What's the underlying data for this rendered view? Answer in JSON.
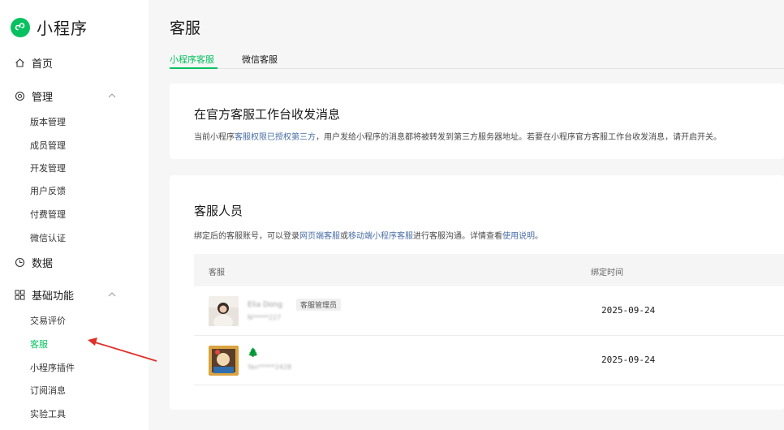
{
  "app": {
    "name": "小程序",
    "page_title": "客服"
  },
  "sidebar": {
    "home": "首页",
    "manage": "管理",
    "manage_items": [
      "版本管理",
      "成员管理",
      "开发管理",
      "用户反馈",
      "付费管理",
      "微信认证"
    ],
    "data": "数据",
    "basic": "基础功能",
    "basic_items": [
      "交易评价",
      "客服",
      "小程序插件",
      "订阅消息",
      "实验工具"
    ]
  },
  "tabs": [
    "小程序客服",
    "微信客服"
  ],
  "card1": {
    "title": "在官方客服工作台收发消息",
    "desc_prefix": "当前小程序",
    "desc_link": "客服权限已授权第三方",
    "desc_suffix": "，用户发给小程序的消息都将被转发到第三方服务器地址。若要在小程序官方客服工作台收发消息，请开启开关。"
  },
  "card2": {
    "title": "客服人员",
    "desc_prefix": "绑定后的客服账号，可以登录",
    "desc_link1": "网页端客服",
    "desc_mid1": "或",
    "desc_link2": "移动端小程序客服",
    "desc_mid2": "进行客服沟通。详情查看",
    "desc_link3": "使用说明",
    "desc_end": "。"
  },
  "table": {
    "headers": [
      "客服",
      "绑定时间"
    ],
    "rows": [
      {
        "name": "Elia Dong",
        "id": "N*****227",
        "badge": "客服管理员",
        "date": "2025-09-24"
      },
      {
        "name": "🌲",
        "id": "Yan*****2428",
        "badge": "",
        "date": "2025-09-24"
      }
    ]
  },
  "colors": {
    "accent": "#07c160",
    "link": "#4a6fa5",
    "annotation_arrow": "#e0302a"
  }
}
